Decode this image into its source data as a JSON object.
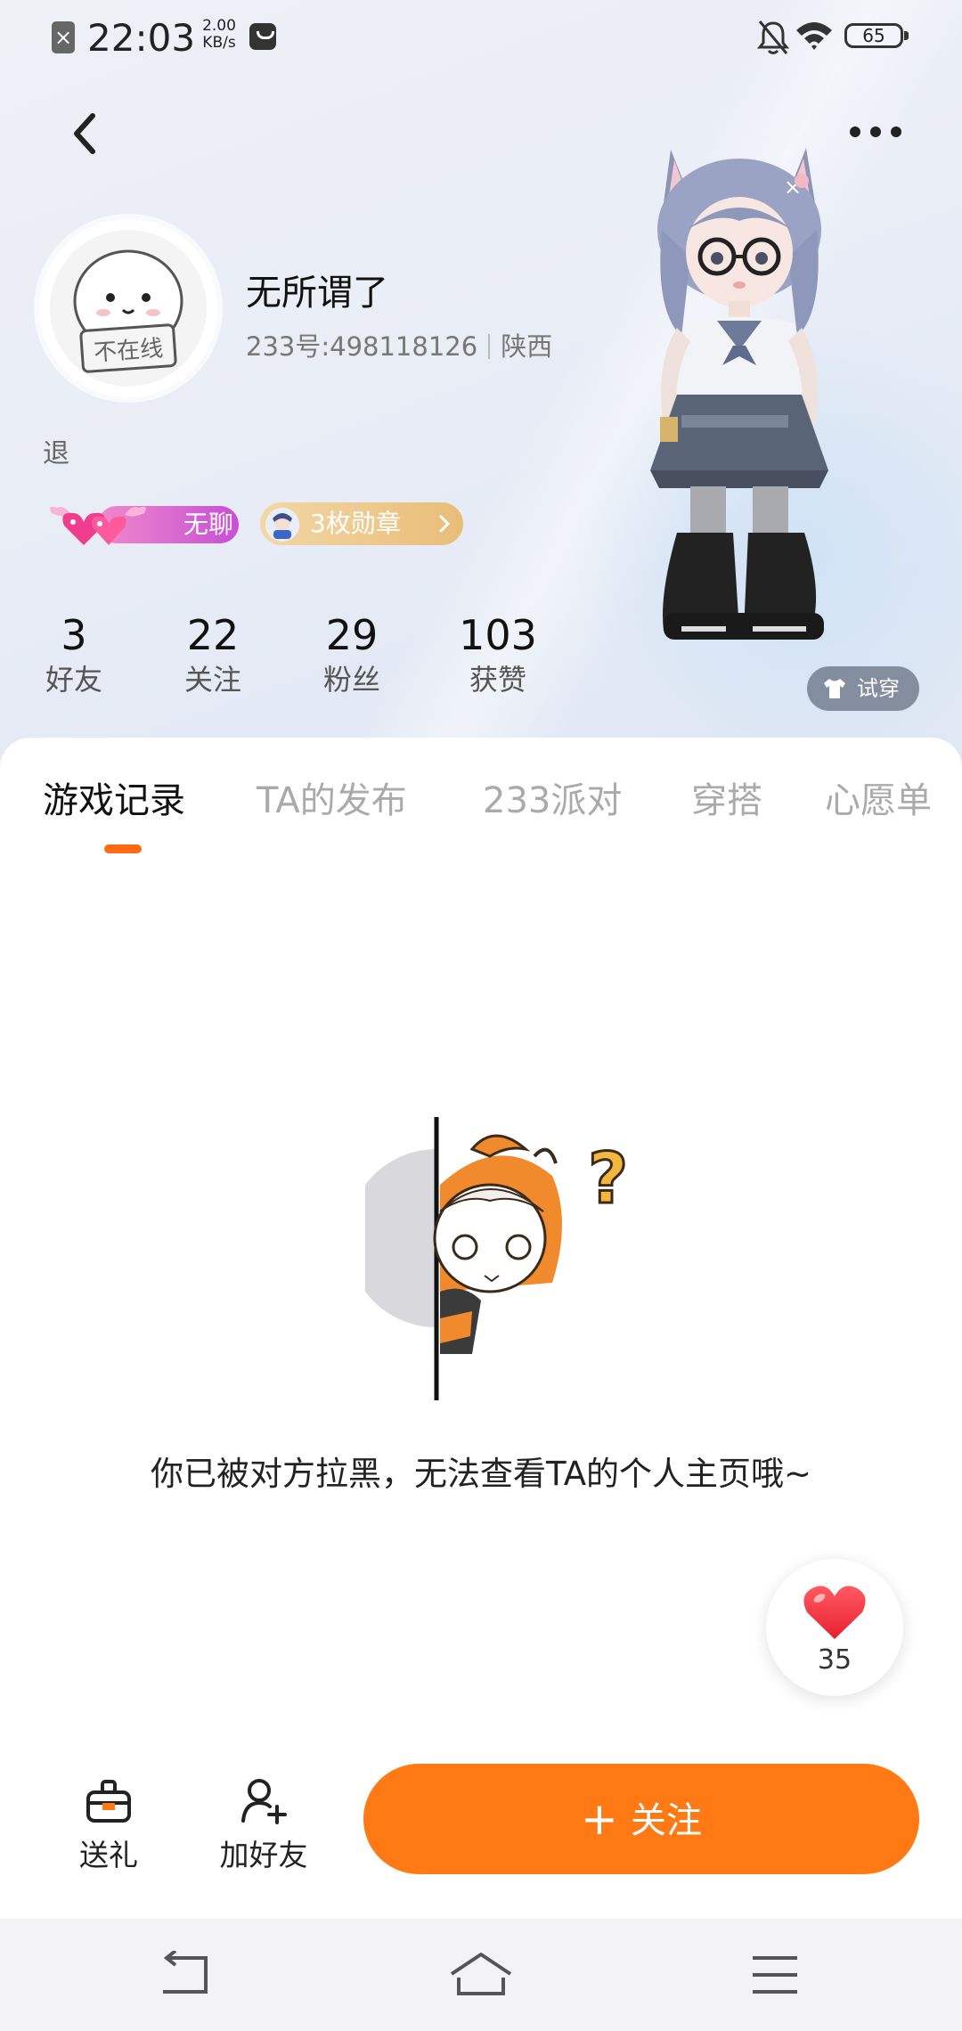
{
  "status_bar": {
    "time": "22:03",
    "net_speed_value": "2.00",
    "net_speed_unit": "KB/s",
    "battery": "65"
  },
  "profile": {
    "username": "无所谓了",
    "id_label": "233号:498118126",
    "region": "陕西",
    "signature": "退",
    "avatar_text": "不在线",
    "mood_badge": "无聊",
    "medal_badge": "3枚勋章",
    "try_on": "试穿"
  },
  "stats": [
    {
      "value": "3",
      "label": "好友"
    },
    {
      "value": "22",
      "label": "关注"
    },
    {
      "value": "29",
      "label": "粉丝"
    },
    {
      "value": "103",
      "label": "获赞"
    }
  ],
  "tabs": [
    {
      "label": "游戏记录",
      "active": true
    },
    {
      "label": "TA的发布",
      "active": false
    },
    {
      "label": "233派对",
      "active": false
    },
    {
      "label": "穿搭",
      "active": false
    },
    {
      "label": "心愿单",
      "active": false
    }
  ],
  "empty_state": {
    "message": "你已被对方拉黑，无法查看TA的个人主页哦~"
  },
  "like": {
    "count": "35"
  },
  "actions": {
    "gift": "送礼",
    "add_friend": "加好友",
    "follow": "关注"
  },
  "colors": {
    "accent": "#ff7a14",
    "tab_indicator": "#ff6a13",
    "mood_badge": "#d65fd8",
    "medal_badge": "#e9c07f"
  }
}
